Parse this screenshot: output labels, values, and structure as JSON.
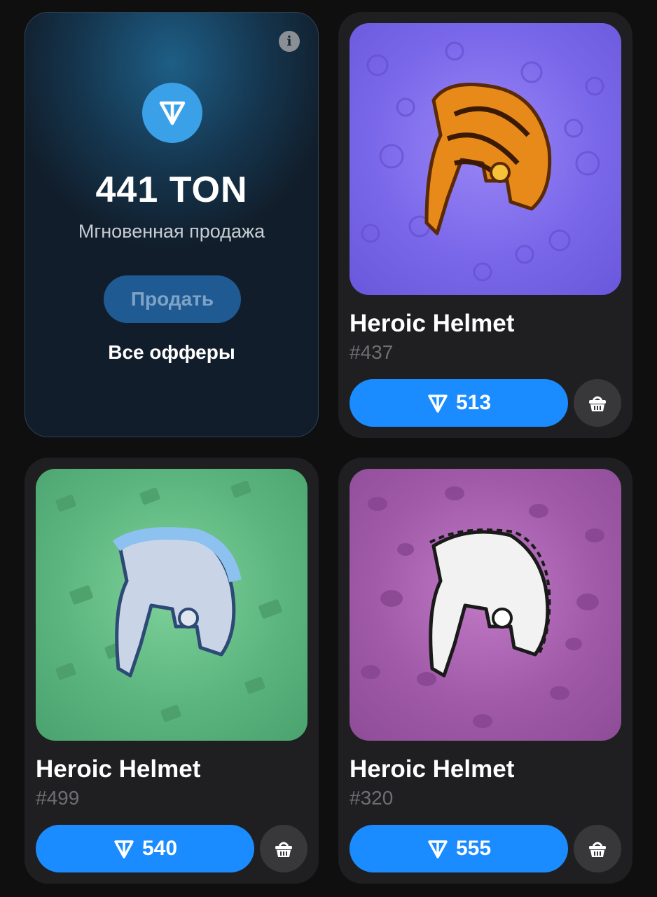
{
  "offer": {
    "amount": "441 TON",
    "subtitle": "Мгновенная продажа",
    "sell_label": "Продать",
    "all_offers_label": "Все офферы",
    "info_icon": "i"
  },
  "items": [
    {
      "title": "Heroic Helmet",
      "number": "#437",
      "price": "513",
      "background": "#7a68ea",
      "helmet": "tiger-helmet"
    },
    {
      "title": "Heroic Helmet",
      "number": "#499",
      "price": "540",
      "background": "#5cb57f",
      "helmet": "silver-blue-helmet"
    },
    {
      "title": "Heroic Helmet",
      "number": "#320",
      "price": "555",
      "background": "#a05aa8",
      "helmet": "white-sketch-helmet"
    }
  ],
  "colors": {
    "accent": "#1a8cff",
    "card": "#1f1f21",
    "page": "#0f0f10"
  },
  "icons": [
    "ton-logo-icon",
    "info-icon",
    "ton-icon",
    "basket-icon"
  ]
}
